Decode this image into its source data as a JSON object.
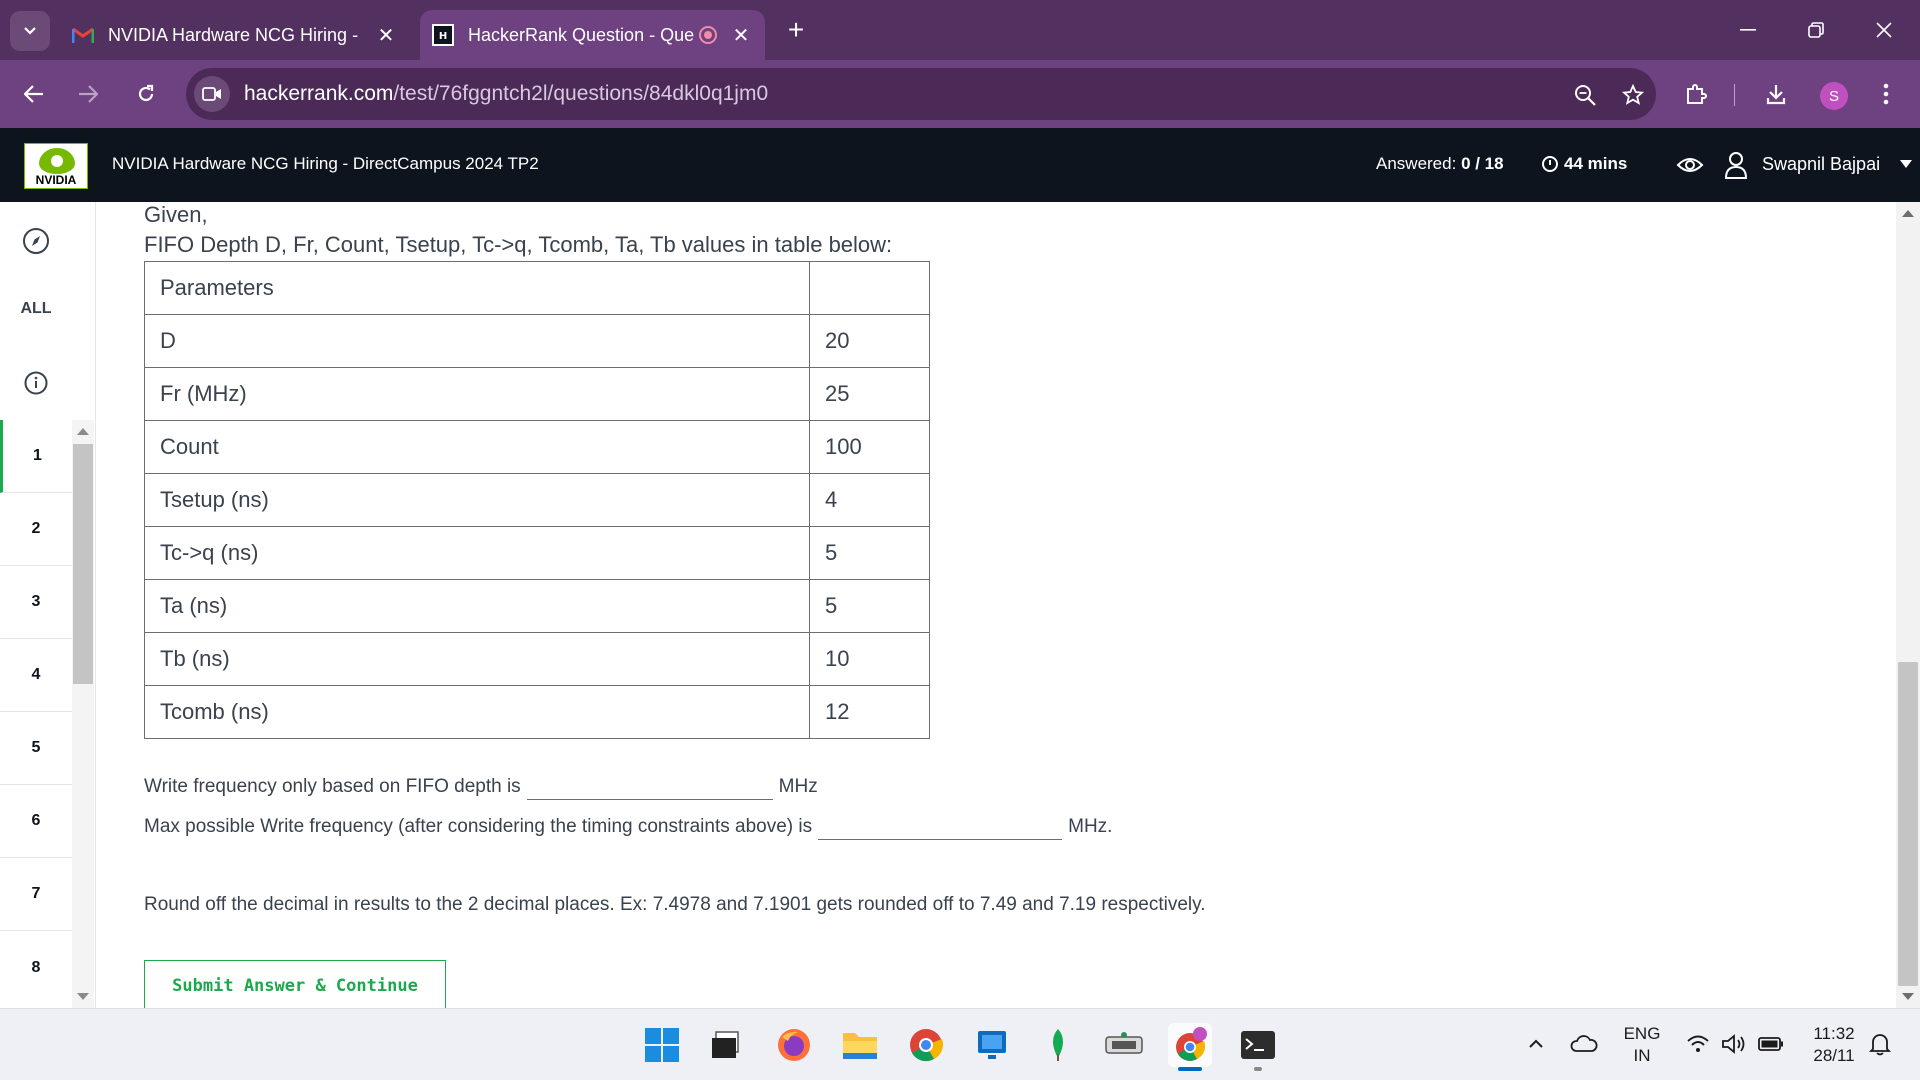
{
  "browser": {
    "tabs": [
      {
        "title": "NVIDIA Hardware NCG Hiring -",
        "icon": "gmail-icon",
        "active": false
      },
      {
        "title": "HackerRank Question - Que",
        "icon": "hackerrank-icon",
        "active": true
      }
    ],
    "url_domain": "hackerrank.com",
    "url_path": "/test/76fggntch2l/questions/84dkl0q1jm0",
    "profile_initial": "S"
  },
  "header": {
    "logo_text": "NVIDIA",
    "test_title": "NVIDIA Hardware NCG Hiring - DirectCampus 2024 TP2",
    "answered_label": "Answered:",
    "answered_value": "0 / 18",
    "time_left": "44 mins",
    "user_name": "Swapnil Bajpai"
  },
  "sidebar": {
    "all_label": "ALL",
    "questions": [
      "1",
      "2",
      "3",
      "4",
      "5",
      "6",
      "7",
      "8"
    ],
    "active_question": "1"
  },
  "question": {
    "given": "Given,",
    "intro": "FIFO Depth D, Fr, Count, Tsetup, Tc->q, Tcomb, Ta, Tb values in table below:",
    "table_header": [
      "Parameters",
      ""
    ],
    "rows": [
      {
        "param": "D",
        "value": "20"
      },
      {
        "param": "Fr (MHz)",
        "value": "25"
      },
      {
        "param": "Count",
        "value": "100"
      },
      {
        "param": "Tsetup (ns)",
        "value": "4"
      },
      {
        "param": "Tc->q (ns)",
        "value": "5"
      },
      {
        "param": "Ta (ns)",
        "value": "5"
      },
      {
        "param": "Tb (ns)",
        "value": "10"
      },
      {
        "param": "Tcomb (ns)",
        "value": "12"
      }
    ],
    "blank1_prefix": "Write frequency only based on FIFO depth is",
    "blank1_suffix": "MHz",
    "blank2_prefix": "Max possible Write frequency (after considering the timing constraints above) is",
    "blank2_suffix": "MHz.",
    "rounding_note": "Round off the decimal in results to the 2 decimal places. Ex: 7.4978 and 7.1901 gets rounded off to 7.49 and 7.19 respectively.",
    "submit_label": "Submit Answer & Continue"
  },
  "taskbar": {
    "apps": [
      "windows-start-icon",
      "file-icon",
      "firefox-icon",
      "file-explorer-icon",
      "chrome-icon",
      "app-icon",
      "mongodb-icon",
      "dictionary-icon",
      "chrome-profile-icon",
      "terminal-icon"
    ],
    "lang_line1": "ENG",
    "lang_line2": "IN",
    "time": "11:32",
    "date": "28/11"
  },
  "colors": {
    "tab_bar": "#52305f",
    "toolbar": "#6e4180",
    "header": "#0e141e",
    "accent_green": "#1ba94c"
  }
}
